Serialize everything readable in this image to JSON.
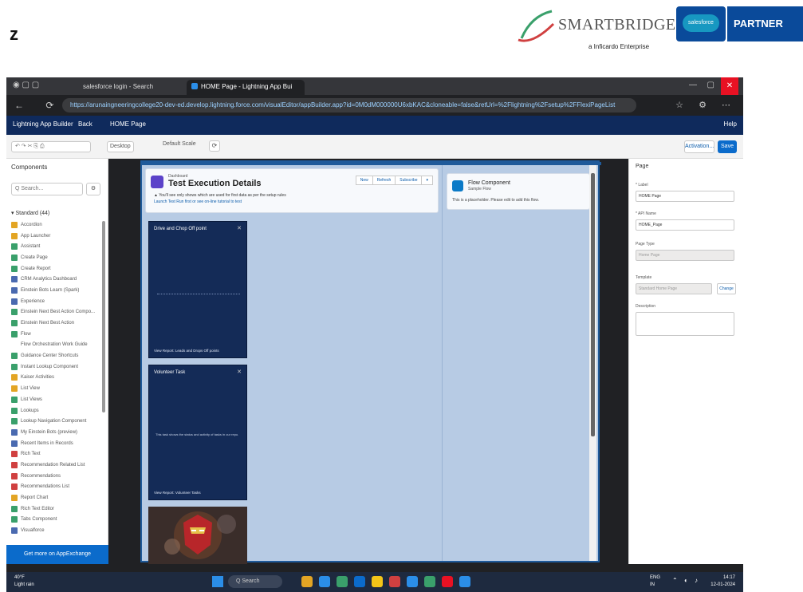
{
  "slide": {
    "corner_letter": "z",
    "logo_brand": "SMARTBRIDGE",
    "logo_sub": "a Inficardo Enterprise",
    "logo_cloud": "salesforce",
    "logo_partner": "PARTNER"
  },
  "browser": {
    "tab1_label": "salesforce login - Search",
    "tab2_label": "HOME Page - Lightning App Bui",
    "url": "https://arunaingneeringcollege20-dev-ed.develop.lightning.force.com/visualEditor/appBuilder.app?id=0M0dM000000U6xbKAC&cloneable=false&retUrl=%2Flightning%2Fsetup%2FFlexiPageList",
    "close_glyph": "✕",
    "min_glyph": "—",
    "max_glyph": "▢"
  },
  "sf_nav": {
    "app_builder": "Lightning App Builder",
    "back": "Back",
    "page_name": "HOME Page",
    "help": "Help"
  },
  "toolbar": {
    "undo_placeholder": "↶ ↷ ✂ ⎘ ⎙",
    "device": "Desktop",
    "zoom": "Default Scale",
    "refresh": "⟳",
    "activation_label": "Activation...",
    "save_label": "Save"
  },
  "left_panel": {
    "title": "Components",
    "search_placeholder": "Q Search...",
    "search_btn": "⚙",
    "section": "▾ Standard (44)",
    "items": [
      {
        "label": "Accordion",
        "color": "#e3a524"
      },
      {
        "label": "App Launcher",
        "color": "#e3a524"
      },
      {
        "label": "Assistant",
        "color": "#3aa06b"
      },
      {
        "label": "Create Page",
        "color": "#3aa06b"
      },
      {
        "label": "Create Report",
        "color": "#3aa06b"
      },
      {
        "label": "CRM Analytics Dashboard",
        "color": "#4a6ab0"
      },
      {
        "label": "Einstein Bots Learn (Spark)",
        "color": "#4a6ab0"
      },
      {
        "label": "Experience",
        "color": "#4a6ab0"
      },
      {
        "label": "Einstein Next Best Action Compo...",
        "color": "#3aa06b"
      },
      {
        "label": "Einstein Next Best Action",
        "color": "#3aa06b"
      },
      {
        "label": "Flow",
        "color": "#3aa06b"
      },
      {
        "label": "Flow Orchestration Work Guide",
        "color": "#ffffff"
      },
      {
        "label": "Guidance Center Shortcuts",
        "color": "#3aa06b"
      },
      {
        "label": "Instant Lookup Component",
        "color": "#3aa06b"
      },
      {
        "label": "Kaiser Activities",
        "color": "#e3a524"
      },
      {
        "label": "List View",
        "color": "#e3a524"
      },
      {
        "label": "List Views",
        "color": "#3aa06b"
      },
      {
        "label": "Lookups",
        "color": "#3aa06b"
      },
      {
        "label": "Lookup Navigation Component",
        "color": "#3aa06b"
      },
      {
        "label": "My Einstein Bots (preview)",
        "color": "#4a6ab0"
      },
      {
        "label": "Recent Items in Records",
        "color": "#4a6ab0"
      },
      {
        "label": "Rich Text",
        "color": "#d04040"
      },
      {
        "label": "Recommendation Related List",
        "color": "#d04040"
      },
      {
        "label": "Recommendations",
        "color": "#d04040"
      },
      {
        "label": "Recommendations List",
        "color": "#d04040"
      },
      {
        "label": "Report Chart",
        "color": "#e3a524"
      },
      {
        "label": "Rich Text Editor",
        "color": "#3aa06b"
      },
      {
        "label": "Tabs Component",
        "color": "#3aa06b"
      },
      {
        "label": "Visualforce",
        "color": "#4a6ab0"
      }
    ],
    "footer": "Get more on AppExchange"
  },
  "canvas": {
    "header_object": "Dashboard",
    "header_title": "Test Execution Details",
    "header_line1": "▲ You'll see only shows which are used for first data as per the setup rules",
    "header_line2": "Launch Test Run first or see on-line tutorial to test",
    "header_buttons": [
      "New",
      "Refresh",
      "Subscribe",
      "▾"
    ],
    "flow_title": "Flow Component",
    "flow_sub": "Sample Flow",
    "flow_desc": "This is a placeholder. Please edit to add this flow.",
    "card1_title": "Drive and Chop Off point",
    "card1_bottom": "View Report: Leads and Drops Off points",
    "card2_title": "Volunteer Task",
    "card2_mid": "This task shows the status and activity of tasks in our repo.",
    "card2_bottom": "View Report: Volunteer Tasks",
    "close_glyph": "✕"
  },
  "right_panel": {
    "title": "Page",
    "label_label": "* Label",
    "label_value": "HOME Page",
    "api_label": "* API Name",
    "api_value": "HOME_Page",
    "type_label": "Page Type",
    "type_value": "Home Page",
    "template_label": "Template",
    "template_value": "Standard Home Page",
    "change_btn": "Change",
    "desc_label": "Description"
  },
  "taskbar": {
    "weather_temp": "40°F",
    "weather_desc": "Light rain",
    "search_label": "Q Search",
    "lang": "ENG",
    "lang_region": "IN",
    "time": "14:17",
    "date": "12-01-2024",
    "app_colors": [
      "#e3a524",
      "#2b8ee8",
      "#3aa06b",
      "#0b6bcb",
      "#f3c518",
      "#d04040",
      "#2b8ee8",
      "#3aa06b",
      "#e81123",
      "#2b8ee8"
    ]
  }
}
